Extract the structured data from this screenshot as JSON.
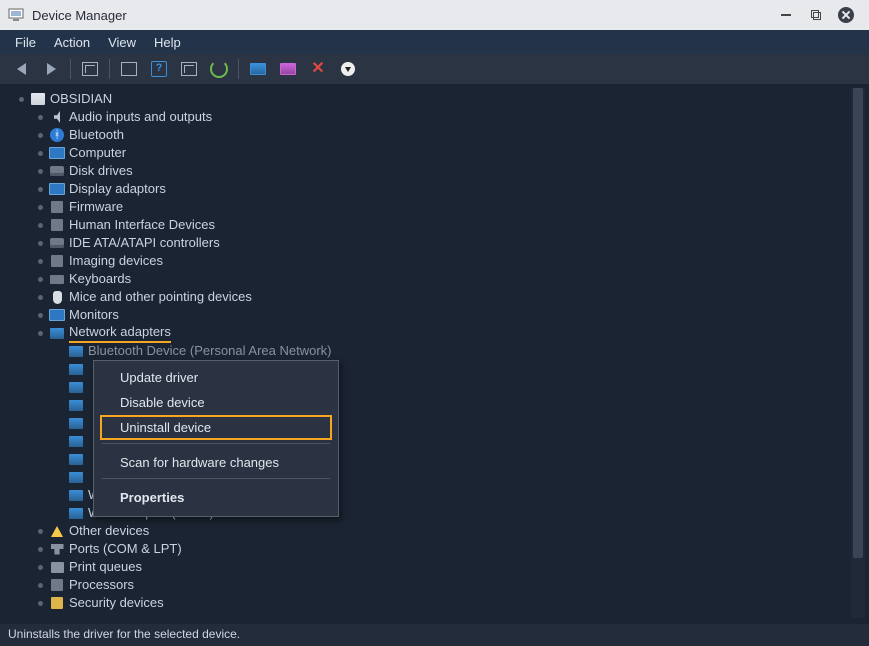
{
  "window": {
    "title": "Device Manager"
  },
  "menu": {
    "file": "File",
    "action": "Action",
    "view": "View",
    "help": "Help"
  },
  "tree": {
    "root": "OBSIDIAN",
    "categories": {
      "audio": "Audio inputs and outputs",
      "bluetooth": "Bluetooth",
      "computer": "Computer",
      "disk": "Disk drives",
      "display": "Display adaptors",
      "firmware": "Firmware",
      "hid": "Human Interface Devices",
      "ide": "IDE ATA/ATAPI controllers",
      "imaging": "Imaging devices",
      "keyboards": "Keyboards",
      "mice": "Mice and other pointing devices",
      "monitors": "Monitors",
      "network": "Network adapters",
      "other": "Other devices",
      "ports": "Ports (COM & LPT)",
      "printq": "Print queues",
      "processors": "Processors",
      "security": "Security devices"
    },
    "network_devices": {
      "btpan": "Bluetooth Device (Personal Area Network)",
      "wan_pptp": "WAN Miniport (PPTP)",
      "wan_sstp": "WAN Miniport (SSTP)"
    }
  },
  "context_menu": {
    "update": "Update driver",
    "disable": "Disable device",
    "uninstall": "Uninstall device",
    "scan": "Scan for hardware changes",
    "properties": "Properties"
  },
  "status": "Uninstalls the driver for the selected device."
}
